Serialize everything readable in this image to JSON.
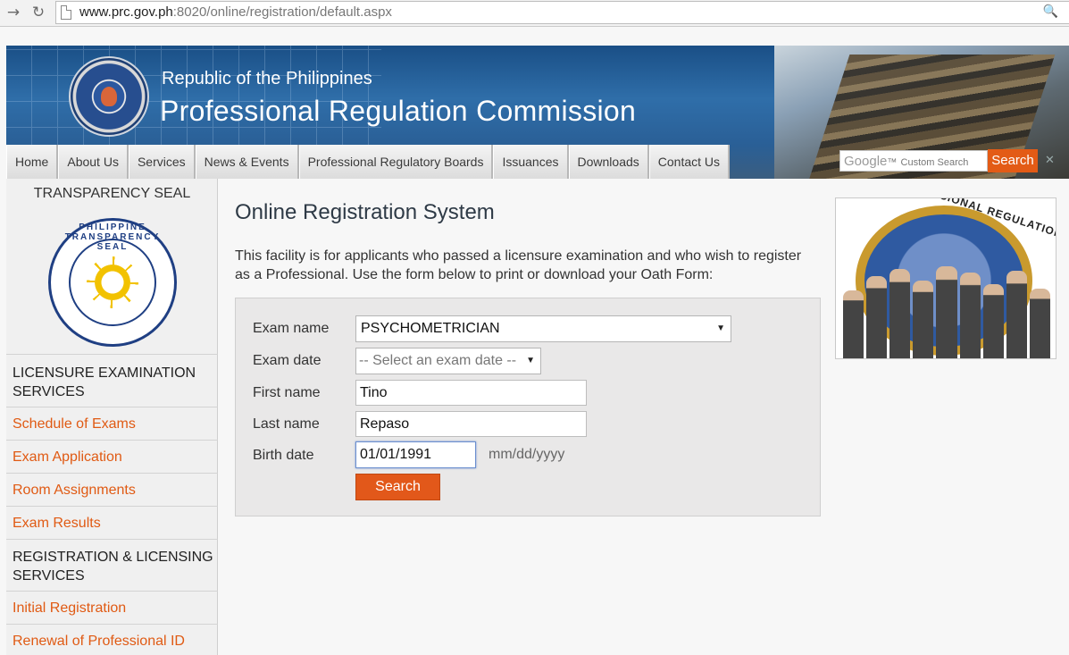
{
  "browser": {
    "url_host": "www.prc.gov.ph",
    "url_rest": ":8020/online/registration/default.aspx"
  },
  "banner": {
    "subtitle": "Republic of the Philippines",
    "title": "Professional Regulation Commission"
  },
  "topnav": [
    "Home",
    "About Us",
    "Services",
    "News & Events",
    "Professional Regulatory Boards",
    "Issuances",
    "Downloads",
    "Contact Us"
  ],
  "google_search": {
    "brand": "Google",
    "tm": "™",
    "placeholder": "Custom Search",
    "button": "Search"
  },
  "sidebar": {
    "seal_title": "TRANSPARENCY SEAL",
    "seal_text": "PHILIPPINE TRANSPARENCY SEAL",
    "section1": "LICENSURE EXAMINATION SERVICES",
    "links1": [
      "Schedule of Exams",
      "Exam Application",
      "Room Assignments",
      "Exam Results"
    ],
    "section2": "REGISTRATION & LICENSING SERVICES",
    "links2": [
      "Initial Registration",
      "Renewal of Professional ID"
    ]
  },
  "main": {
    "title": "Online Registration System",
    "description": "This facility is for applicants who passed a licensure examination and who wish to register as a Professional. Use the form below to print or download your Oath Form:"
  },
  "form": {
    "exam_name_label": "Exam name",
    "exam_name_value": "PSYCHOMETRICIAN",
    "exam_date_label": "Exam date",
    "exam_date_value": "-- Select an exam date --",
    "first_name_label": "First name",
    "first_name_value": "Tino",
    "last_name_label": "Last name",
    "last_name_value": "Repaso",
    "birth_date_label": "Birth date",
    "birth_date_value": "01/01/1991",
    "birth_date_hint": "mm/dd/yyyy",
    "search_button": "Search"
  },
  "right_image": {
    "seal_text": "PROFESSIONAL REGULATION COMMIS"
  },
  "colors": {
    "accent": "#e05a13",
    "banner_blue": "#2f6ea9"
  }
}
